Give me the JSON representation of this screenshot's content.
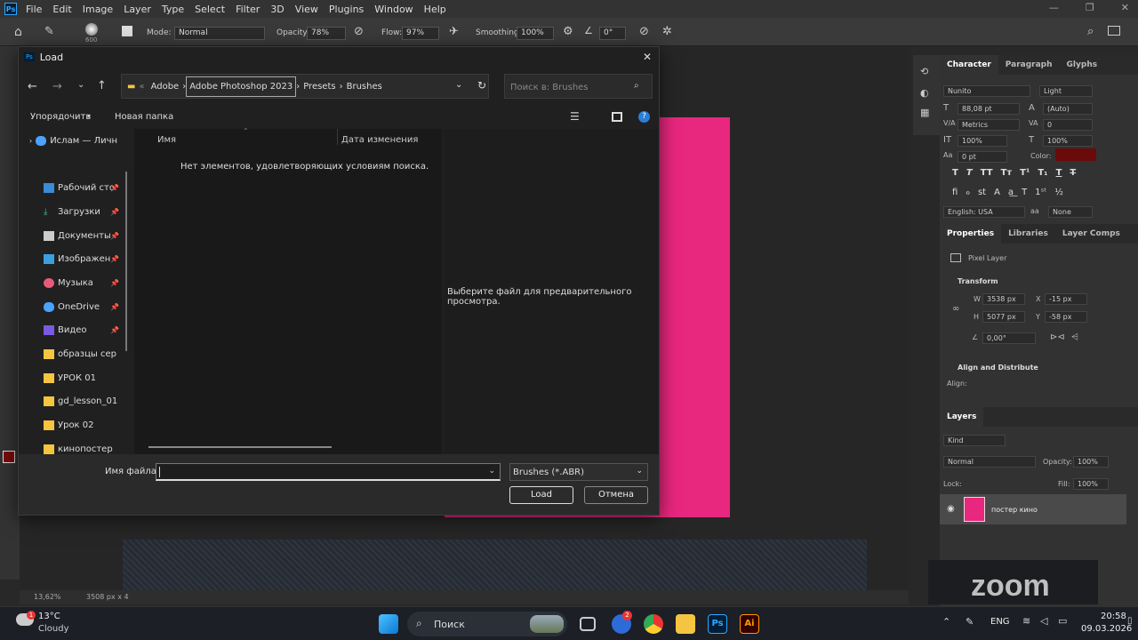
{
  "menubar": {
    "items": [
      "File",
      "Edit",
      "Image",
      "Layer",
      "Type",
      "Select",
      "Filter",
      "3D",
      "View",
      "Plugins",
      "Window",
      "Help"
    ]
  },
  "options": {
    "brush_size": "600",
    "mode_label": "Mode:",
    "mode_value": "Normal",
    "opacity_label": "Opacity:",
    "opacity_value": "78%",
    "flow_label": "Flow:",
    "flow_value": "97%",
    "smoothing_label": "Smoothing:",
    "smoothing_value": "100%",
    "angle_value": "0°"
  },
  "dialog": {
    "title": "Load",
    "breadcrumb": [
      "Adobe",
      "Adobe Photoshop 2023",
      "Presets",
      "Brushes"
    ],
    "search_placeholder": "Поиск в: Brushes",
    "organize": "Упорядочить",
    "new_folder": "Новая папка",
    "nav": [
      {
        "label": "Ислам — Личн"
      },
      {
        "label": "Рабочий сто"
      },
      {
        "label": "Загрузки"
      },
      {
        "label": "Документы"
      },
      {
        "label": "Изображен"
      },
      {
        "label": "Музыка"
      },
      {
        "label": "OneDrive"
      },
      {
        "label": "Видео"
      },
      {
        "label": "образцы сер"
      },
      {
        "label": "УРОК 01"
      },
      {
        "label": "gd_lesson_01"
      },
      {
        "label": "Урок 02"
      },
      {
        "label": "кинопостер"
      }
    ],
    "col_name": "Имя",
    "col_date": "Дата изменения",
    "empty_msg": "Нет элементов, удовлетворяющих условиям поиска.",
    "preview_msg": "Выберите файл для предварительного просмотра.",
    "filename_label": "Имя файла:",
    "filename_value": "",
    "filetype": "Brushes (*.ABR)",
    "load_btn": "Load",
    "cancel_btn": "Отмена"
  },
  "character": {
    "tabs": [
      "Character",
      "Paragraph",
      "Glyphs"
    ],
    "font": "Nunito",
    "style": "Light",
    "size": "88,08 pt",
    "leading": "(Auto)",
    "kerning": "Metrics",
    "tracking": "0",
    "vscale": "100%",
    "hscale": "100%",
    "baseline": "0 pt",
    "color_label": "Color:",
    "color": "#6b0a0a",
    "language": "English: USA",
    "aa": "None"
  },
  "properties": {
    "tabs": [
      "Properties",
      "Libraries",
      "Layer Comps"
    ],
    "kind": "Pixel Layer",
    "transform": "Transform",
    "w": "3538 px",
    "x": "-15 px",
    "h": "5077 px",
    "y": "-58 px",
    "angle": "0,00°",
    "align": "Align and Distribute",
    "align_sub": "Align:"
  },
  "layers": {
    "tab": "Layers",
    "kind": "Kind",
    "blend": "Normal",
    "opacity_label": "Opacity:",
    "opacity": "100%",
    "lock_label": "Lock:",
    "fill_label": "Fill:",
    "fill": "100%",
    "layer_name": "постер кино"
  },
  "status": {
    "zoom": "13,62%",
    "dims": "3508 px x 4"
  },
  "taskbar": {
    "temp": "13°C",
    "weather": "Cloudy",
    "search": "Поиск",
    "lang": "ENG",
    "time": "20:58",
    "date": "09.03.2026",
    "badge": "2"
  },
  "zoom_watermark": "zoom",
  "colors": {
    "poster": "#e8277e",
    "accent": "#31a8ff"
  }
}
